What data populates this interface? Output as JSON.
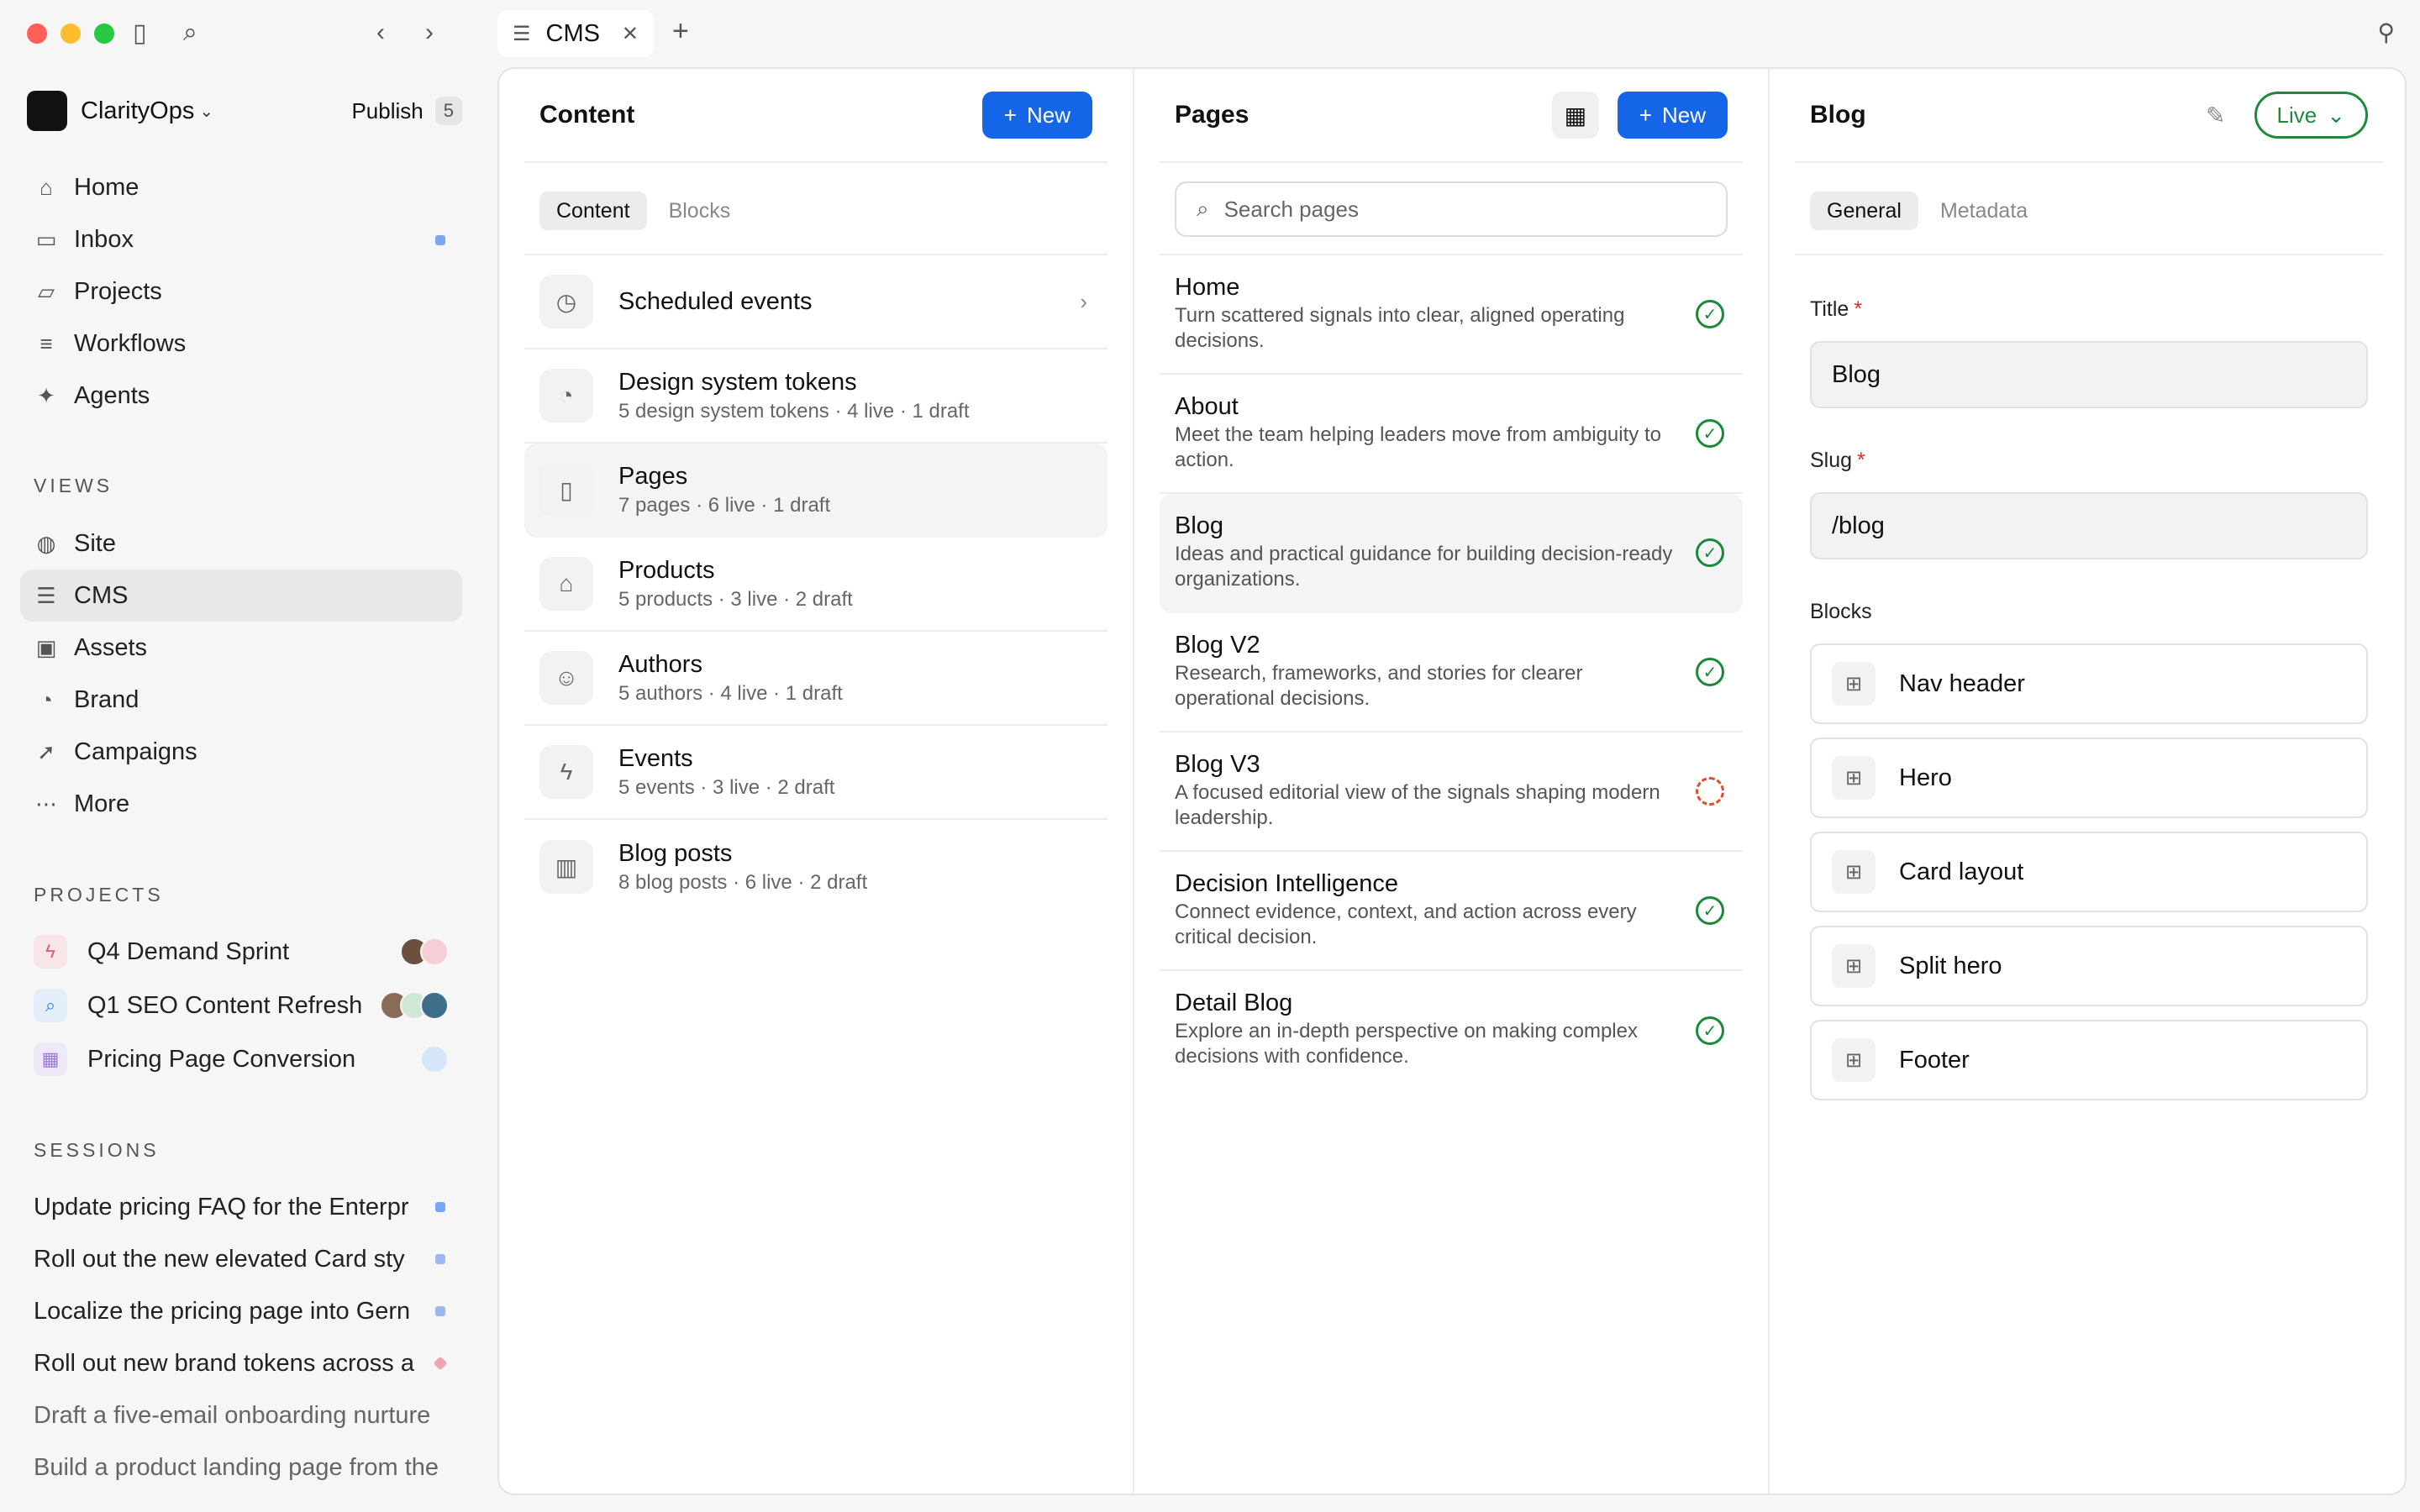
{
  "window": {
    "tab_label": "CMS"
  },
  "sidebar": {
    "workspace": "ClarityOps",
    "publish_label": "Publish",
    "publish_count": "5",
    "nav": [
      {
        "label": "Home",
        "icon": "home-icon"
      },
      {
        "label": "Inbox",
        "icon": "inbox-icon"
      },
      {
        "label": "Projects",
        "icon": "folder-icon"
      },
      {
        "label": "Workflows",
        "icon": "workflow-icon"
      },
      {
        "label": "Agents",
        "icon": "sparkle-icon"
      }
    ],
    "views_label": "VIEWS",
    "views": [
      {
        "label": "Site",
        "icon": "globe-icon"
      },
      {
        "label": "CMS",
        "icon": "database-icon"
      },
      {
        "label": "Assets",
        "icon": "image-icon"
      },
      {
        "label": "Brand",
        "icon": "palette-icon"
      },
      {
        "label": "Campaigns",
        "icon": "rocket-icon"
      },
      {
        "label": "More",
        "icon": "more-icon"
      }
    ],
    "projects_label": "PROJECTS",
    "projects": [
      {
        "label": "Q4 Demand Sprint",
        "icon": "bolt-icon",
        "color": "#f3e3e6"
      },
      {
        "label": "Q1 SEO Content Refresh",
        "icon": "search-icon",
        "color": "#e3edf9"
      },
      {
        "label": "Pricing Page Conversion",
        "icon": "table-icon",
        "color": "#ede6f7"
      }
    ],
    "sessions_label": "SESSIONS",
    "sessions": [
      {
        "label": "Update pricing FAQ for the Enterpr",
        "color": "#7aa7f5"
      },
      {
        "label": "Roll out the new elevated Card sty",
        "color": "#9db8ee"
      },
      {
        "label": "Localize the pricing page into Gern",
        "color": "#9db8ee"
      },
      {
        "label": "Roll out new brand tokens across a",
        "color": "#f2a3b3"
      },
      {
        "label": "Draft a five-email onboarding nurture",
        "color": ""
      },
      {
        "label": "Build a product landing page from the",
        "color": ""
      }
    ]
  },
  "content": {
    "title": "Content",
    "new_label": "New",
    "tabs": [
      {
        "label": "Content",
        "active": true
      },
      {
        "label": "Blocks",
        "active": false
      }
    ],
    "items": [
      {
        "title": "Scheduled events",
        "subtitle": "",
        "icon": "clock-icon"
      },
      {
        "title": "Design system tokens",
        "subtitle": "5 design system tokens · 4 live · 1 draft",
        "icon": "palette-icon"
      },
      {
        "title": "Pages",
        "subtitle": "7 pages · 6 live · 1 draft",
        "icon": "file-icon"
      },
      {
        "title": "Products",
        "subtitle": "5 products · 3 live · 2 draft",
        "icon": "store-icon"
      },
      {
        "title": "Authors",
        "subtitle": "5 authors · 4 live · 1 draft",
        "icon": "user-icon"
      },
      {
        "title": "Events",
        "subtitle": "5 events · 3 live · 2 draft",
        "icon": "bolt-icon"
      },
      {
        "title": "Blog posts",
        "subtitle": "8 blog posts · 6 live · 2 draft",
        "icon": "book-icon"
      }
    ]
  },
  "pages": {
    "title": "Pages",
    "new_label": "New",
    "search_placeholder": "Search pages",
    "items": [
      {
        "title": "Home",
        "desc": "Turn scattered signals into clear, aligned operating decisions.",
        "status": "live"
      },
      {
        "title": "About",
        "desc": "Meet the team helping leaders move from ambiguity to action.",
        "status": "live"
      },
      {
        "title": "Blog",
        "desc": "Ideas and practical guidance for building decision-ready organizations.",
        "status": "live"
      },
      {
        "title": "Blog V2",
        "desc": "Research, frameworks, and stories for clearer operational decisions.",
        "status": "live"
      },
      {
        "title": "Blog V3",
        "desc": "A focused editorial view of the signals shaping modern leadership.",
        "status": "draft"
      },
      {
        "title": "Decision Intelligence",
        "desc": "Connect evidence, context, and action across every critical decision.",
        "status": "live"
      },
      {
        "title": "Detail Blog",
        "desc": "Explore an in-depth perspective on making complex decisions with confidence.",
        "status": "live"
      }
    ]
  },
  "detail": {
    "title": "Blog",
    "status_label": "Live",
    "tabs": [
      {
        "label": "General",
        "active": true
      },
      {
        "label": "Metadata",
        "active": false
      }
    ],
    "title_label": "Title",
    "title_value": "Blog",
    "slug_label": "Slug",
    "slug_value": "/blog",
    "blocks_label": "Blocks",
    "blocks": [
      "Nav header",
      "Hero",
      "Card layout",
      "Split hero",
      "Footer"
    ]
  },
  "colors": {
    "accent": "#1565e8",
    "live": "#1f8a3e",
    "draft": "#d1552a"
  }
}
